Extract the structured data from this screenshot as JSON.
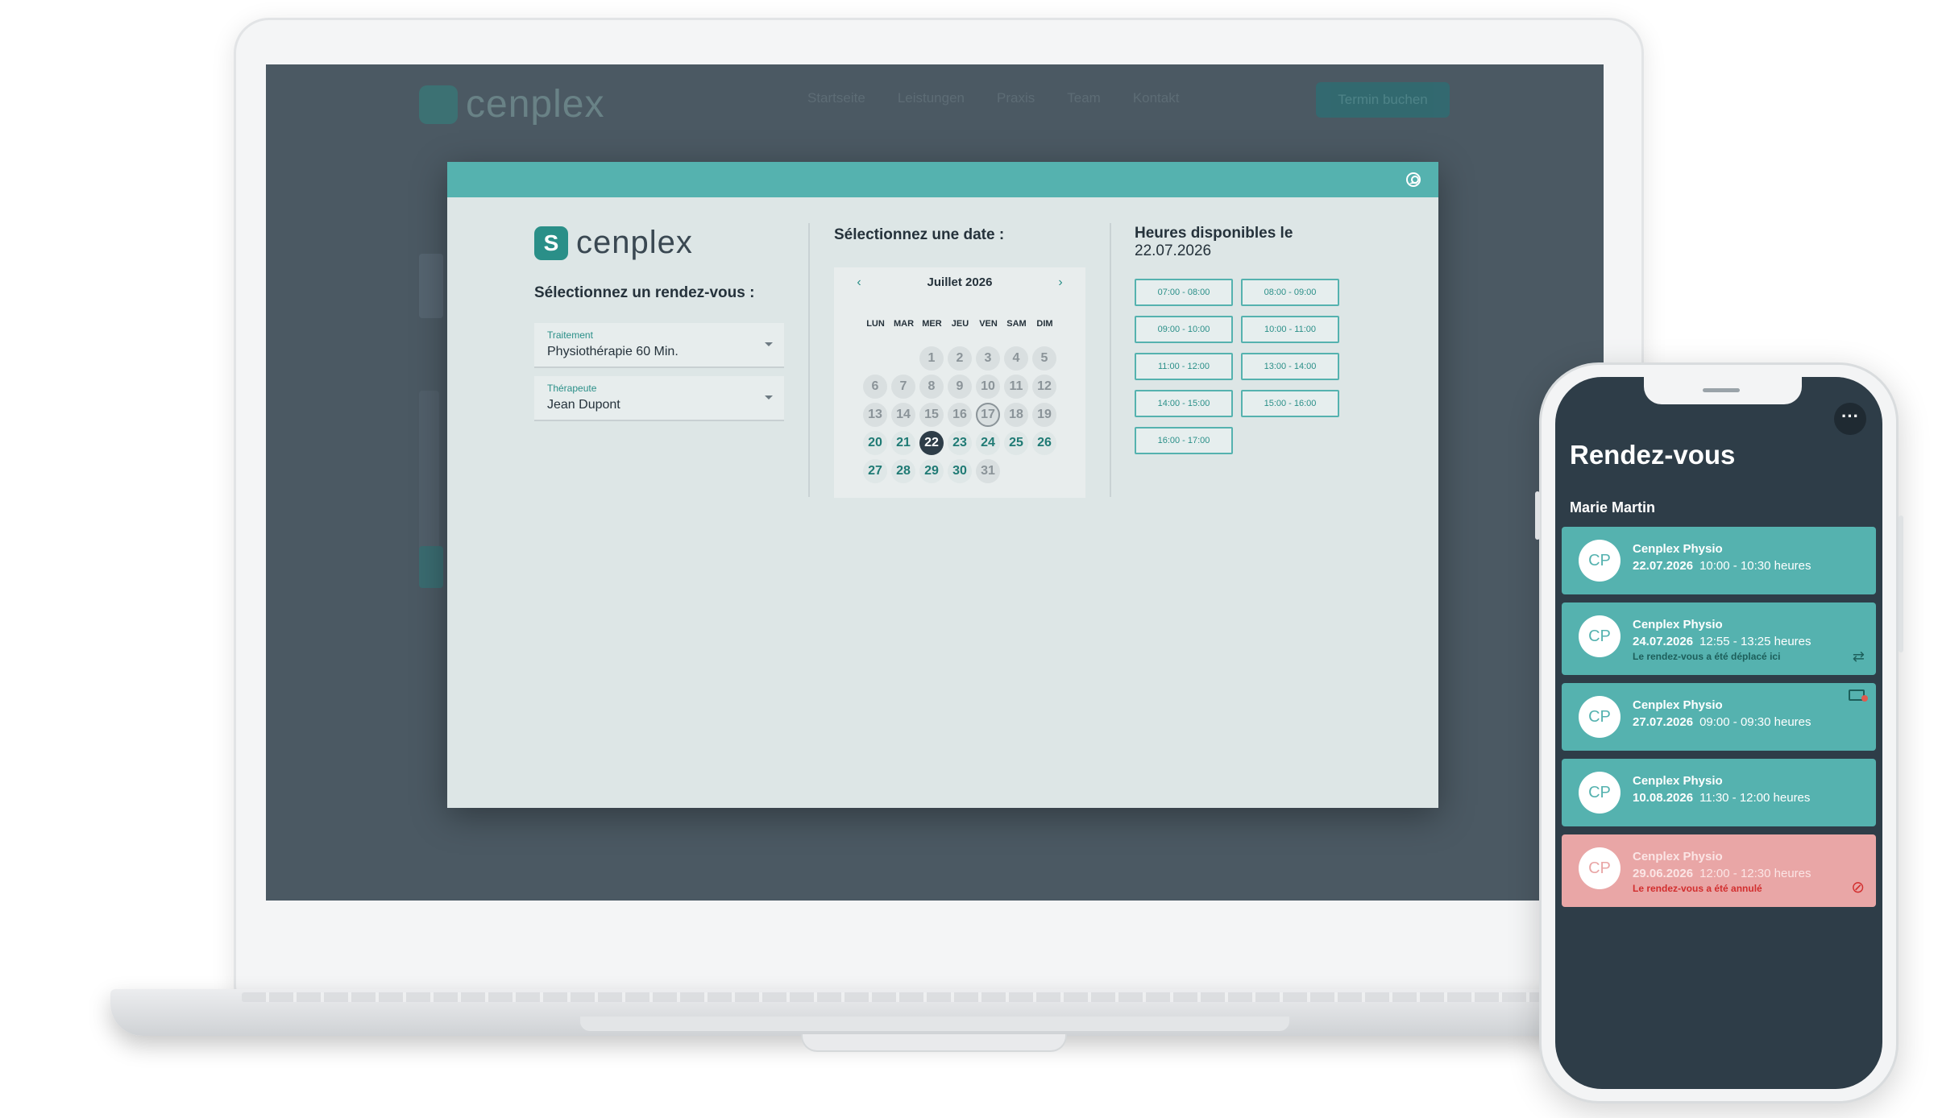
{
  "website": {
    "brand": "cenplex",
    "nav": [
      "Startseite",
      "Leistungen",
      "Praxis",
      "Team",
      "Kontakt"
    ],
    "cta": "Termin buchen"
  },
  "modal": {
    "brand": "cenplex",
    "select_title": "Sélectionnez un rendez-vous :",
    "treatment": {
      "label": "Traitement",
      "value": "Physiothérapie 60 Min."
    },
    "therapist": {
      "label": "Thérapeute",
      "value": "Jean Dupont"
    },
    "date_title": "Sélectionnez une date :",
    "calendar": {
      "month": "Juillet 2026",
      "weekdays": [
        "LUN",
        "MAR",
        "MER",
        "JEU",
        "VEN",
        "SAM",
        "DIM"
      ],
      "leading_blanks": 2,
      "days": 31,
      "today": 17,
      "selected": 22,
      "available_from": 20,
      "available_to": 30
    },
    "hours_title": "Heures disponibles le",
    "hours_date": "22.07.2026",
    "slots": [
      "07:00 - 08:00",
      "08:00 - 09:00",
      "09:00 - 10:00",
      "10:00 - 11:00",
      "11:00 - 12:00",
      "13:00 - 14:00",
      "14:00 - 15:00",
      "15:00 - 16:00",
      "16:00 - 17:00"
    ]
  },
  "phone": {
    "title": "Rendez-vous",
    "user": "Marie Martin",
    "more_icon": "more-icon",
    "appointments": [
      {
        "initials": "CP",
        "clinic": "Cenplex Physio",
        "date": "22.07.2026",
        "time": "10:00 - 10:30 heures",
        "status": "normal",
        "note": "",
        "icon": ""
      },
      {
        "initials": "CP",
        "clinic": "Cenplex Physio",
        "date": "24.07.2026",
        "time": "12:55 - 13:25 heures",
        "status": "moved",
        "note": "Le rendez-vous a été déplacé ici",
        "icon": "swap-icon"
      },
      {
        "initials": "CP",
        "clinic": "Cenplex Physio",
        "date": "27.07.2026",
        "time": "09:00 - 09:30 heures",
        "status": "message",
        "note": "",
        "icon": "mail-icon"
      },
      {
        "initials": "CP",
        "clinic": "Cenplex Physio",
        "date": "10.08.2026",
        "time": "11:30 - 12:00 heures",
        "status": "normal",
        "note": "",
        "icon": ""
      },
      {
        "initials": "CP",
        "clinic": "Cenplex Physio",
        "date": "29.06.2026",
        "time": "12:00 - 12:30 heures",
        "status": "cancelled",
        "note": "Le rendez-vous a été annulé",
        "icon": "cancel-icon"
      }
    ]
  },
  "colors": {
    "accent": "#55b2af",
    "accent_dark": "#2a8f88",
    "dark": "#2e3d48",
    "cancel": "#e9a6a6"
  }
}
